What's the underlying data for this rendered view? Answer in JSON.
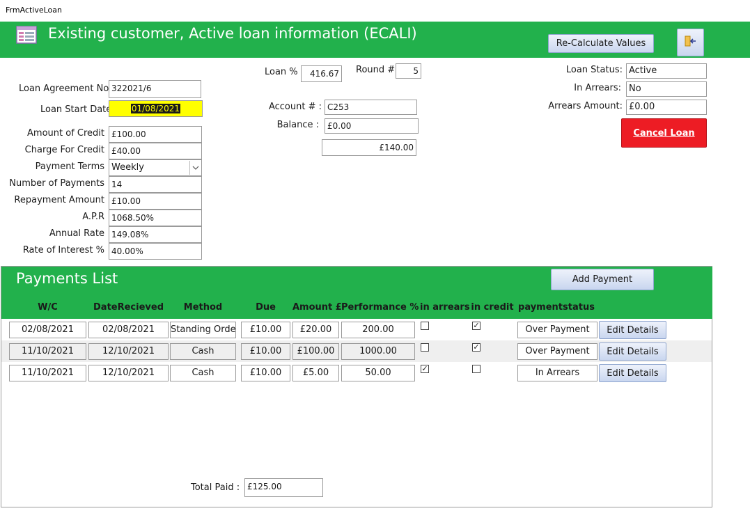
{
  "window": {
    "title": "FrmActiveLoan"
  },
  "header": {
    "title": "Existing customer, Active loan information (ECALI)",
    "recalc_label": "Re-Calculate Values",
    "accent": "#22b14c"
  },
  "loan": {
    "agreement_label": "Loan Agreement No.",
    "agreement_value": "322021/6",
    "start_label": "Loan Start Date",
    "start_value": "01/08/2021",
    "credit_label": "Amount of Credit",
    "credit_value": "£100.00",
    "charge_label": "Charge For Credit",
    "charge_value": "£40.00",
    "terms_label": "Payment Terms",
    "terms_value": "Weekly",
    "numpay_label": "Number of Payments",
    "numpay_value": "14",
    "repay_label": "Repayment Amount",
    "repay_value": "£10.00",
    "apr_label": "A.P.R",
    "apr_value": "1068.50%",
    "annual_label": "Annual Rate",
    "annual_value": "149.08%",
    "interest_label": "Rate of Interest %",
    "interest_value": "40.00%"
  },
  "middle": {
    "loan_pct_label": "Loan %",
    "loan_pct_value": "416.67",
    "round_label": "Round #",
    "round_value": "5",
    "account_label": "Account # :",
    "account_value": "C253",
    "balance_label": "Balance :",
    "balance_value": "£0.00",
    "total_value": "£140.00"
  },
  "status": {
    "loan_status_label": "Loan Status:",
    "loan_status_value": "Active",
    "arrears_label": "In Arrears:",
    "arrears_value": "No",
    "arrears_amount_label": "Arrears Amount:",
    "arrears_amount_value": "£0.00",
    "cancel_label": "Cancel Loan",
    "cancel_color": "#ed1c24"
  },
  "payments": {
    "title": "Payments List",
    "add_label": "Add Payment",
    "columns": [
      "W/C",
      "DateRecieved",
      "Method",
      "Due",
      "Amount £",
      "Performance %",
      "in arrears",
      "in credit",
      "paymentstatus"
    ],
    "rows": [
      {
        "wc": "02/08/2021",
        "received": "02/08/2021",
        "method": "Standing Orde",
        "due": "£10.00",
        "amount": "£20.00",
        "performance": "200.00",
        "in_arrears": "",
        "in_credit": "✓",
        "status": "Over Payment",
        "edit": "Edit Details"
      },
      {
        "wc": "11/10/2021",
        "received": "12/10/2021",
        "method": "Cash",
        "due": "£10.00",
        "amount": "£100.00",
        "performance": "1000.00",
        "in_arrears": "",
        "in_credit": "✓",
        "status": "Over Payment",
        "edit": "Edit Details"
      },
      {
        "wc": "11/10/2021",
        "received": "12/10/2021",
        "method": "Cash",
        "due": "£10.00",
        "amount": "£5.00",
        "performance": "50.00",
        "in_arrears": "✓",
        "in_credit": "",
        "status": "In Arrears",
        "edit": "Edit Details"
      }
    ],
    "total_label": "Total Paid :",
    "total_value": "£125.00"
  }
}
